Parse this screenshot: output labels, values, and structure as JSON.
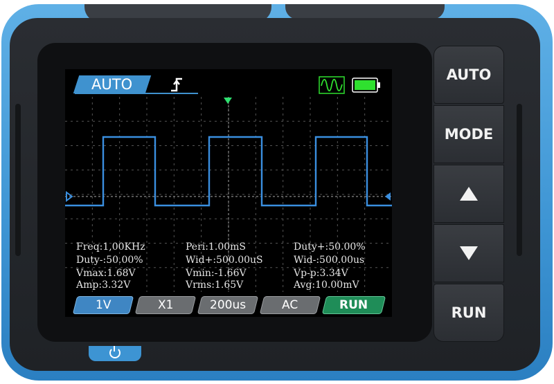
{
  "header": {
    "mode": "AUTO",
    "trigger_icon": "rising-edge-trigger-icon",
    "waveform_icon": "waveform-indicator-icon",
    "battery_icon": "battery-icon"
  },
  "colors": {
    "accent_blue": "#3f92cf",
    "trace": "#3a8fe0",
    "run_green": "#1f8d58",
    "battery_green": "#2fe02f",
    "trigger_marker": "#2fe070"
  },
  "measurements": {
    "freq": "Freq:1,00KHz",
    "peri": "Peri:1.00mS",
    "duty_pos": "Duty+:50.00%",
    "duty_neg": "Duty-:50.00%",
    "wid_pos": "Wid+:500.00uS",
    "wid_neg": "Wid-:500.00us",
    "vmax": "Vmax:1.68V",
    "vmin": "Vmin:-1.66V",
    "vpp": "Vp-p:3.34V",
    "amp": "Amp:3.32V",
    "vrms": "Vrms:1.65V",
    "avg": "Avg:10.00mV"
  },
  "bottom_bar": {
    "volts_div": "1V",
    "probe": "X1",
    "time_div": "200us",
    "coupling": "AC",
    "run_state": "RUN"
  },
  "buttons": {
    "auto": "AUTO",
    "mode": "MODE",
    "up_icon": "triangle-up-icon",
    "down_icon": "triangle-down-icon",
    "run": "RUN"
  },
  "power_icon": "power-icon"
}
